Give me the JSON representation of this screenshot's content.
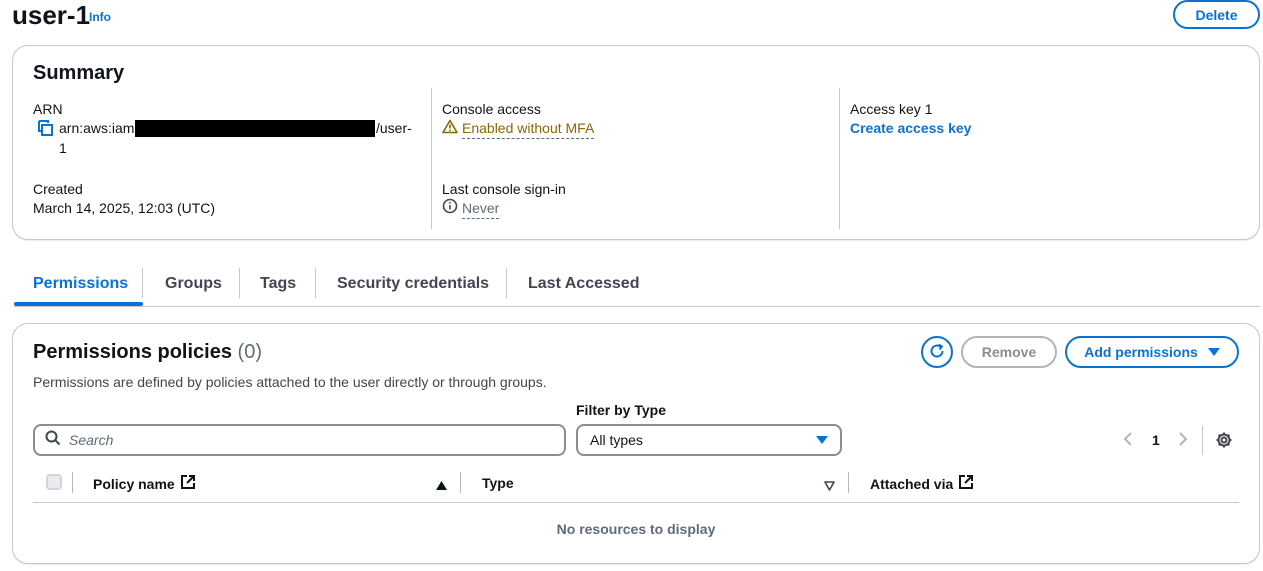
{
  "header": {
    "title": "user-1",
    "info_label": "Info",
    "delete_label": "Delete"
  },
  "summary": {
    "title": "Summary",
    "arn_label": "ARN",
    "arn_prefix": "arn:aws:iam",
    "arn_suffix_line1": "/user-",
    "arn_suffix_line2": "1",
    "created_label": "Created",
    "created_value": "March 14, 2025, 12:03 (UTC)",
    "console_access_label": "Console access",
    "console_access_value": "Enabled without MFA",
    "last_signin_label": "Last console sign-in",
    "last_signin_value": "Never",
    "access_key_label": "Access key 1",
    "create_access_key_label": "Create access key"
  },
  "tabs": [
    {
      "label": "Permissions",
      "active": true
    },
    {
      "label": "Groups",
      "active": false
    },
    {
      "label": "Tags",
      "active": false
    },
    {
      "label": "Security credentials",
      "active": false
    },
    {
      "label": "Last Accessed",
      "active": false
    }
  ],
  "permissions": {
    "title": "Permissions policies",
    "count": "(0)",
    "description": "Permissions are defined by policies attached to the user directly or through groups.",
    "remove_label": "Remove",
    "add_label": "Add permissions",
    "filter_label": "Filter by Type",
    "search_placeholder": "Search",
    "filter_value": "All types",
    "page_number": "1",
    "columns": [
      "Policy name",
      "Type",
      "Attached via"
    ],
    "empty_message": "No resources to display"
  },
  "colors": {
    "accent": "#0972d3",
    "warning": "#8d6605",
    "border": "#c6c6cd"
  }
}
